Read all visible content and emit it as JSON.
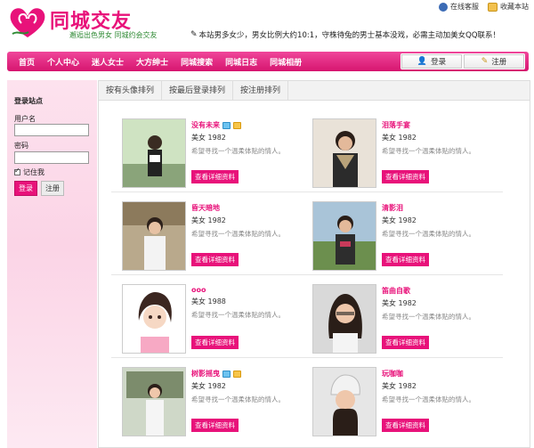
{
  "site": {
    "logo_title": "同城交友",
    "logo_subtitle": "邂逅出色男女 同城约会交友",
    "notice": "本站男多女少，男女比例大约10:1，守株待兔的男士基本没戏，必需主动加美女QQ联系！",
    "topbar": [
      "在线客服",
      "收藏本站"
    ]
  },
  "nav": {
    "items": [
      "首页",
      "个人中心",
      "迷人女士",
      "大方绅士",
      "同城搜索",
      "同城日志",
      "同城相册"
    ],
    "login_label": "登录",
    "register_label": "注册"
  },
  "sidebar": {
    "title": "登录站点",
    "username_label": "用户名",
    "password_label": "密码",
    "remember_label": "记住我",
    "login_button": "登录",
    "register_button": "注册"
  },
  "tabs": [
    "按有头像排列",
    "按最后登录排列",
    "按注册排列"
  ],
  "profiles": [
    {
      "name": "没有未来",
      "meta": "美女 1982",
      "desc": "希望寻找一个温柔体贴的情人。",
      "button": "查看详细资料",
      "badges": true
    },
    {
      "name": "泪落手宴",
      "meta": "美女 1982",
      "desc": "希望寻找一个温柔体贴的情人。",
      "button": "查看详细资料",
      "badges": false
    },
    {
      "name": "昏天暗地",
      "meta": "美女 1982",
      "desc": "希望寻找一个温柔体贴的情人。",
      "button": "查看详细资料",
      "badges": false
    },
    {
      "name": "清影泪",
      "meta": "美女 1982",
      "desc": "希望寻找一个温柔体贴的情人。",
      "button": "查看详细资料",
      "badges": false
    },
    {
      "name": "ooo",
      "meta": "美女 1988",
      "desc": "希望寻找一个温柔体贴的情人。",
      "button": "查看详细资料",
      "badges": false
    },
    {
      "name": "笛曲自歌",
      "meta": "美女 1982",
      "desc": "希望寻找一个温柔体贴的情人。",
      "button": "查看详细资料",
      "badges": false
    },
    {
      "name": "树影摇曳",
      "meta": "美女 1982",
      "desc": "希望寻找一个温柔体贴的情人。",
      "button": "查看详细资料",
      "badges": true
    },
    {
      "name": "玩咖咖",
      "meta": "美女 1982",
      "desc": "希望寻找一个温柔体贴的情人。",
      "button": "查看详细资料",
      "badges": false
    }
  ],
  "colors": {
    "brand": "#e8127a",
    "nav_gradient_top": "#f0469a",
    "nav_gradient_bottom": "#d6156f"
  }
}
